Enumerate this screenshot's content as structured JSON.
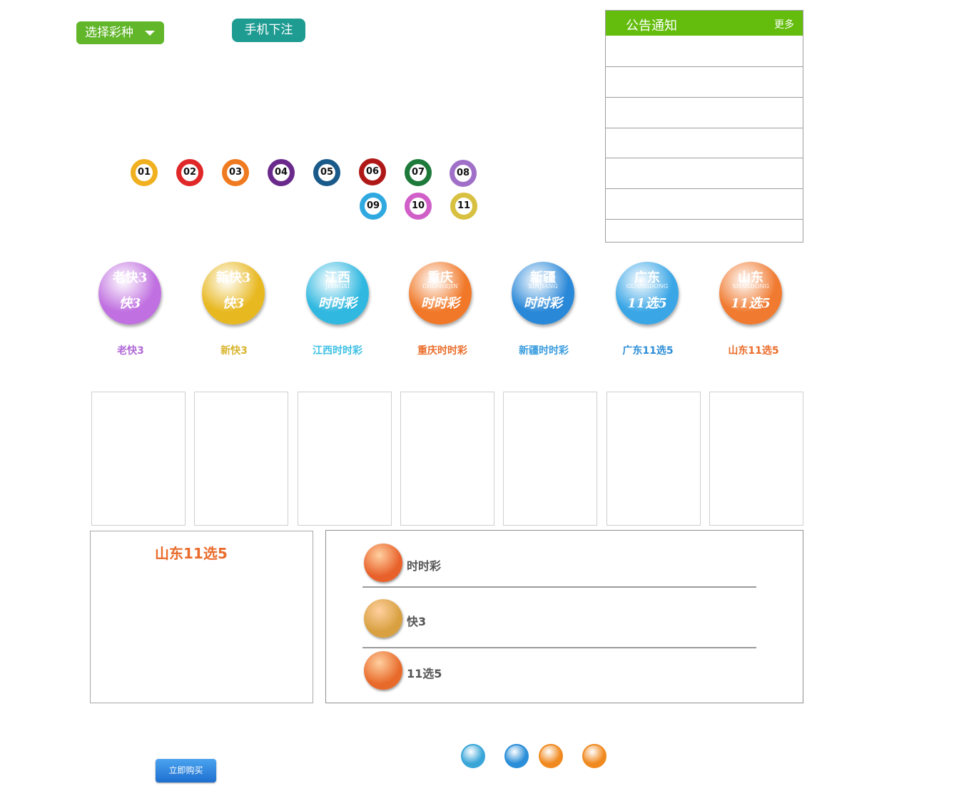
{
  "header": {
    "select_label": "选择彩种",
    "mobile_label": "手机下注"
  },
  "notice": {
    "title": "公告通知",
    "more": "更多"
  },
  "balls": [
    {
      "label": "01",
      "color": "#f0b020"
    },
    {
      "label": "02",
      "color": "#e02828"
    },
    {
      "label": "03",
      "color": "#f07a20"
    },
    {
      "label": "04",
      "color": "#6a2a8c"
    },
    {
      "label": "05",
      "color": "#1a5a8a"
    },
    {
      "label": "06",
      "color": "#b01818"
    },
    {
      "label": "07",
      "color": "#1e7a3a"
    },
    {
      "label": "08",
      "color": "#a070c8"
    },
    {
      "label": "09",
      "color": "#30a8e0"
    },
    {
      "label": "10",
      "color": "#d060c8"
    },
    {
      "label": "11",
      "color": "#d8c040"
    }
  ],
  "lotteries": [
    {
      "label": "老快3",
      "color": "#c070e0",
      "icon_t1": "老快3",
      "icon_t2": "",
      "icon_t3": "快3",
      "label_color": "#b26ad7"
    },
    {
      "label": "新快3",
      "color": "#e8b820",
      "icon_t1": "新快3",
      "icon_t2": "",
      "icon_t3": "快3",
      "label_color": "#d9b52f"
    },
    {
      "label": "江西时时彩",
      "color": "#30b8e0",
      "icon_t1": "江西",
      "icon_t2": "JIANGXI",
      "icon_t3": "时时彩",
      "label_color": "#3fc1e4"
    },
    {
      "label": "重庆时时彩",
      "color": "#f07828",
      "icon_t1": "重庆",
      "icon_t2": "CHONGQIN",
      "icon_t3": "时时彩",
      "label_color": "#ea6e2c"
    },
    {
      "label": "新疆时时彩",
      "color": "#2a88d8",
      "icon_t1": "新疆",
      "icon_t2": "XINJIANG",
      "icon_t3": "时时彩",
      "label_color": "#3a9ddf"
    },
    {
      "label": "广东11选5",
      "color": "#3aa6e6",
      "icon_t1": "广东",
      "icon_t2": "GUANGDONG",
      "icon_t3": "11选5",
      "label_color": "#2f8fd7"
    },
    {
      "label": "山东11选5",
      "color": "#f07a30",
      "icon_t1": "山东",
      "icon_t2": "SHANDONG",
      "icon_t3": "11选5",
      "label_color": "#ea6e2c"
    }
  ],
  "detail": {
    "title": "山东11选5"
  },
  "categories": [
    {
      "label": "时时彩",
      "color": "#e8602a",
      "icon": "ssc-icon"
    },
    {
      "label": "快3",
      "color": "#d8a040",
      "icon": "k3-icon"
    },
    {
      "label": "11选5",
      "color": "#e86a2a",
      "icon": "11x5-icon"
    }
  ],
  "buy_label": "立即购买",
  "footer_icons": [
    {
      "name": "shield-icon",
      "color": "#3aa6d8"
    },
    {
      "name": "compass-icon",
      "color": "#2a8ed8"
    },
    {
      "name": "ball-icon",
      "color": "#f08a20"
    },
    {
      "name": "card-icon",
      "color": "#f08a20"
    }
  ]
}
